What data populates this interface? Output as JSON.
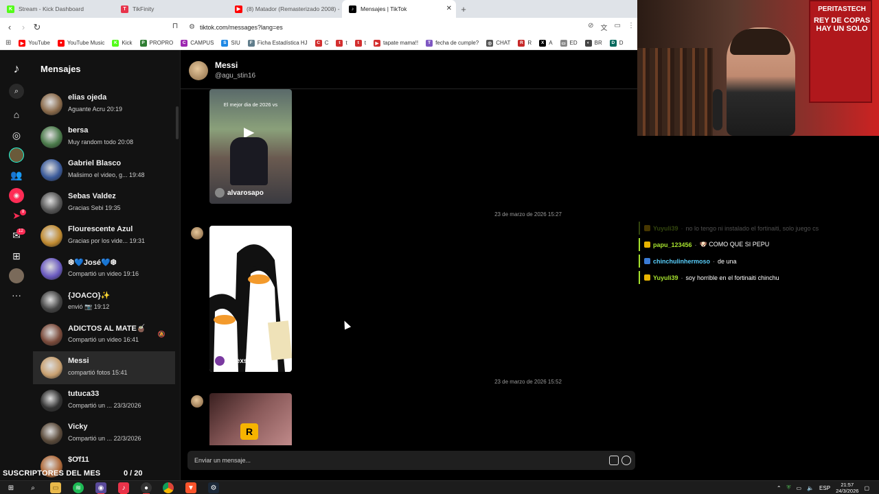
{
  "browser": {
    "tabs": [
      {
        "title": "Stream - Kick Dashboard",
        "icon": "kick-icon",
        "color": "#53fc18",
        "glyph": "K"
      },
      {
        "title": "TikFinity",
        "icon": "tikfinity-icon",
        "color": "#e8334a",
        "glyph": "T"
      },
      {
        "title": "(8) Matador (Remasterizado 2008) -",
        "icon": "youtube-icon",
        "color": "#ff0000",
        "glyph": "▶"
      },
      {
        "title": "Mensajes | TikTok",
        "icon": "tiktok-icon",
        "color": "#000000",
        "glyph": "♪",
        "active": true
      }
    ],
    "url": "tiktok.com/messages?lang=es",
    "bookmarks": [
      {
        "label": "YouTube",
        "color": "#ff0000",
        "glyph": "▶"
      },
      {
        "label": "YouTube Music",
        "color": "#ff0000",
        "glyph": "●"
      },
      {
        "label": "Kick",
        "color": "#53fc18",
        "glyph": "K"
      },
      {
        "label": "PROPRO",
        "color": "#2e7d32",
        "glyph": "P"
      },
      {
        "label": "CAMPUS",
        "color": "#9c27b0",
        "glyph": "C"
      },
      {
        "label": "SIU",
        "color": "#1e88e5",
        "glyph": "S"
      },
      {
        "label": "Ficha Estadística HJ",
        "color": "#607d8b",
        "glyph": "F"
      },
      {
        "label": "C",
        "color": "#d32f2f",
        "glyph": "C"
      },
      {
        "label": "t",
        "color": "#d32f2f",
        "glyph": "t"
      },
      {
        "label": "t",
        "color": "#d32f2f",
        "glyph": "t"
      },
      {
        "label": "tapate mama!!",
        "color": "#d32f2f",
        "glyph": "▶"
      },
      {
        "label": "fecha de cumple?",
        "color": "#7e57c2",
        "glyph": "T"
      },
      {
        "label": "CHAT",
        "color": "#555555",
        "glyph": "◎"
      },
      {
        "label": "R",
        "color": "#c62828",
        "glyph": "R"
      },
      {
        "label": "A",
        "color": "#000000",
        "glyph": "X"
      },
      {
        "label": "ED",
        "color": "#888888",
        "glyph": "▭"
      },
      {
        "label": "BR",
        "color": "#444444",
        "glyph": "◐"
      },
      {
        "label": "D",
        "color": "#00695c",
        "glyph": "D"
      }
    ]
  },
  "tiktok": {
    "messages_title": "Mensajes",
    "rail_badges": {
      "inbox": "8",
      "activity": "12"
    },
    "conversations": [
      {
        "name": "elias ojeda",
        "sub": "Aguante Acru 20:19",
        "color": "#8a6a4a"
      },
      {
        "name": "bersa",
        "sub": "Muy random todo 20:08",
        "color": "#4a7a4a"
      },
      {
        "name": "Gabriel Blasco",
        "sub": "Malisimo el video, g... 19:48",
        "color": "#3a5a9a"
      },
      {
        "name": "Sebas Valdez",
        "sub": "Gracias Sebi 19:35",
        "color": "#555555"
      },
      {
        "name": "Flourescente Azul",
        "sub": "Gracias por los vide... 19:31",
        "color": "#c08a30"
      },
      {
        "name": "❆💙José💙❆",
        "sub": "Compartió un video 19:16",
        "color": "#6a5ac0"
      },
      {
        "name": "{JOACO}✨",
        "sub": "envió 📷 19:12",
        "color": "#444444"
      },
      {
        "name": "ADICTOS AL MATE🧉",
        "sub": "Compartió un video 16:41",
        "color": "#7a4a3a",
        "muted": true
      },
      {
        "name": "Messi",
        "sub": "compartió fotos 15:41",
        "color": "#c8a070",
        "selected": true
      },
      {
        "name": "tutuca33",
        "sub": "Compartió un ...  23/3/2026",
        "color": "#333333"
      },
      {
        "name": "Vicky",
        "sub": "Compartió un ...  22/3/2026",
        "color": "#5a4a3a"
      },
      {
        "name": "$Ơf11",
        "sub": "",
        "color": "#b06a3a"
      }
    ],
    "chat": {
      "name": "Messi",
      "handle": "@agu_stin16",
      "video1_caption": "El mejor dia de 2026 vs",
      "video1_user": "alvarosapo",
      "timestamp1": "23 de marzo de 2026 15:27",
      "video2_user": "Beexs",
      "timestamp2": "23 de marzo de 2026 15:52",
      "composer_placeholder": "Enviar un mensaje..."
    }
  },
  "webcam": {
    "banner_line1": "PERITASTECH",
    "banner_line2": "REY DE COPAS HAY UN SOLO"
  },
  "stream_chat": [
    {
      "user": "Yuyuli39",
      "message": "no lo tengo ni instalado el fortinaiti, solo juego cs",
      "user_color": "#a6e22e",
      "faded": true
    },
    {
      "user": "papu_123456",
      "message": "🐶 COMO QUE SI PEPU",
      "user_color": "#a6e22e"
    },
    {
      "user": "chinchulinhermoso",
      "message": "de una",
      "user_color": "#5ad1ff"
    },
    {
      "user": "Yuyuli39",
      "message": "soy horrible en el fortinaiti chinchu",
      "user_color": "#a6e22e"
    }
  ],
  "subs_overlay": {
    "label": "SUSCRIPTORES DEL MES",
    "count": "0  / 20"
  },
  "taskbar": {
    "language": "ESP",
    "time": "21:57",
    "date": "24/3/2026"
  }
}
